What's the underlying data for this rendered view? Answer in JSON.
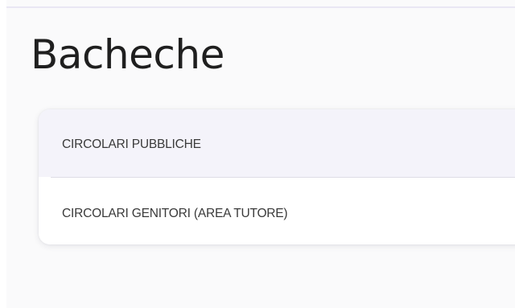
{
  "page": {
    "title": "Bacheche"
  },
  "boards": {
    "items": [
      {
        "label": "CIRCOLARI PUBBLICHE"
      },
      {
        "label": "CIRCOLARI GENITORI (AREA TUTORE)"
      }
    ]
  },
  "colors": {
    "background": "#fafafb",
    "card": "#ffffff",
    "highlighted_row": "#f4f3fa",
    "text": "#3a3a3a",
    "title": "#1f1f1f"
  }
}
